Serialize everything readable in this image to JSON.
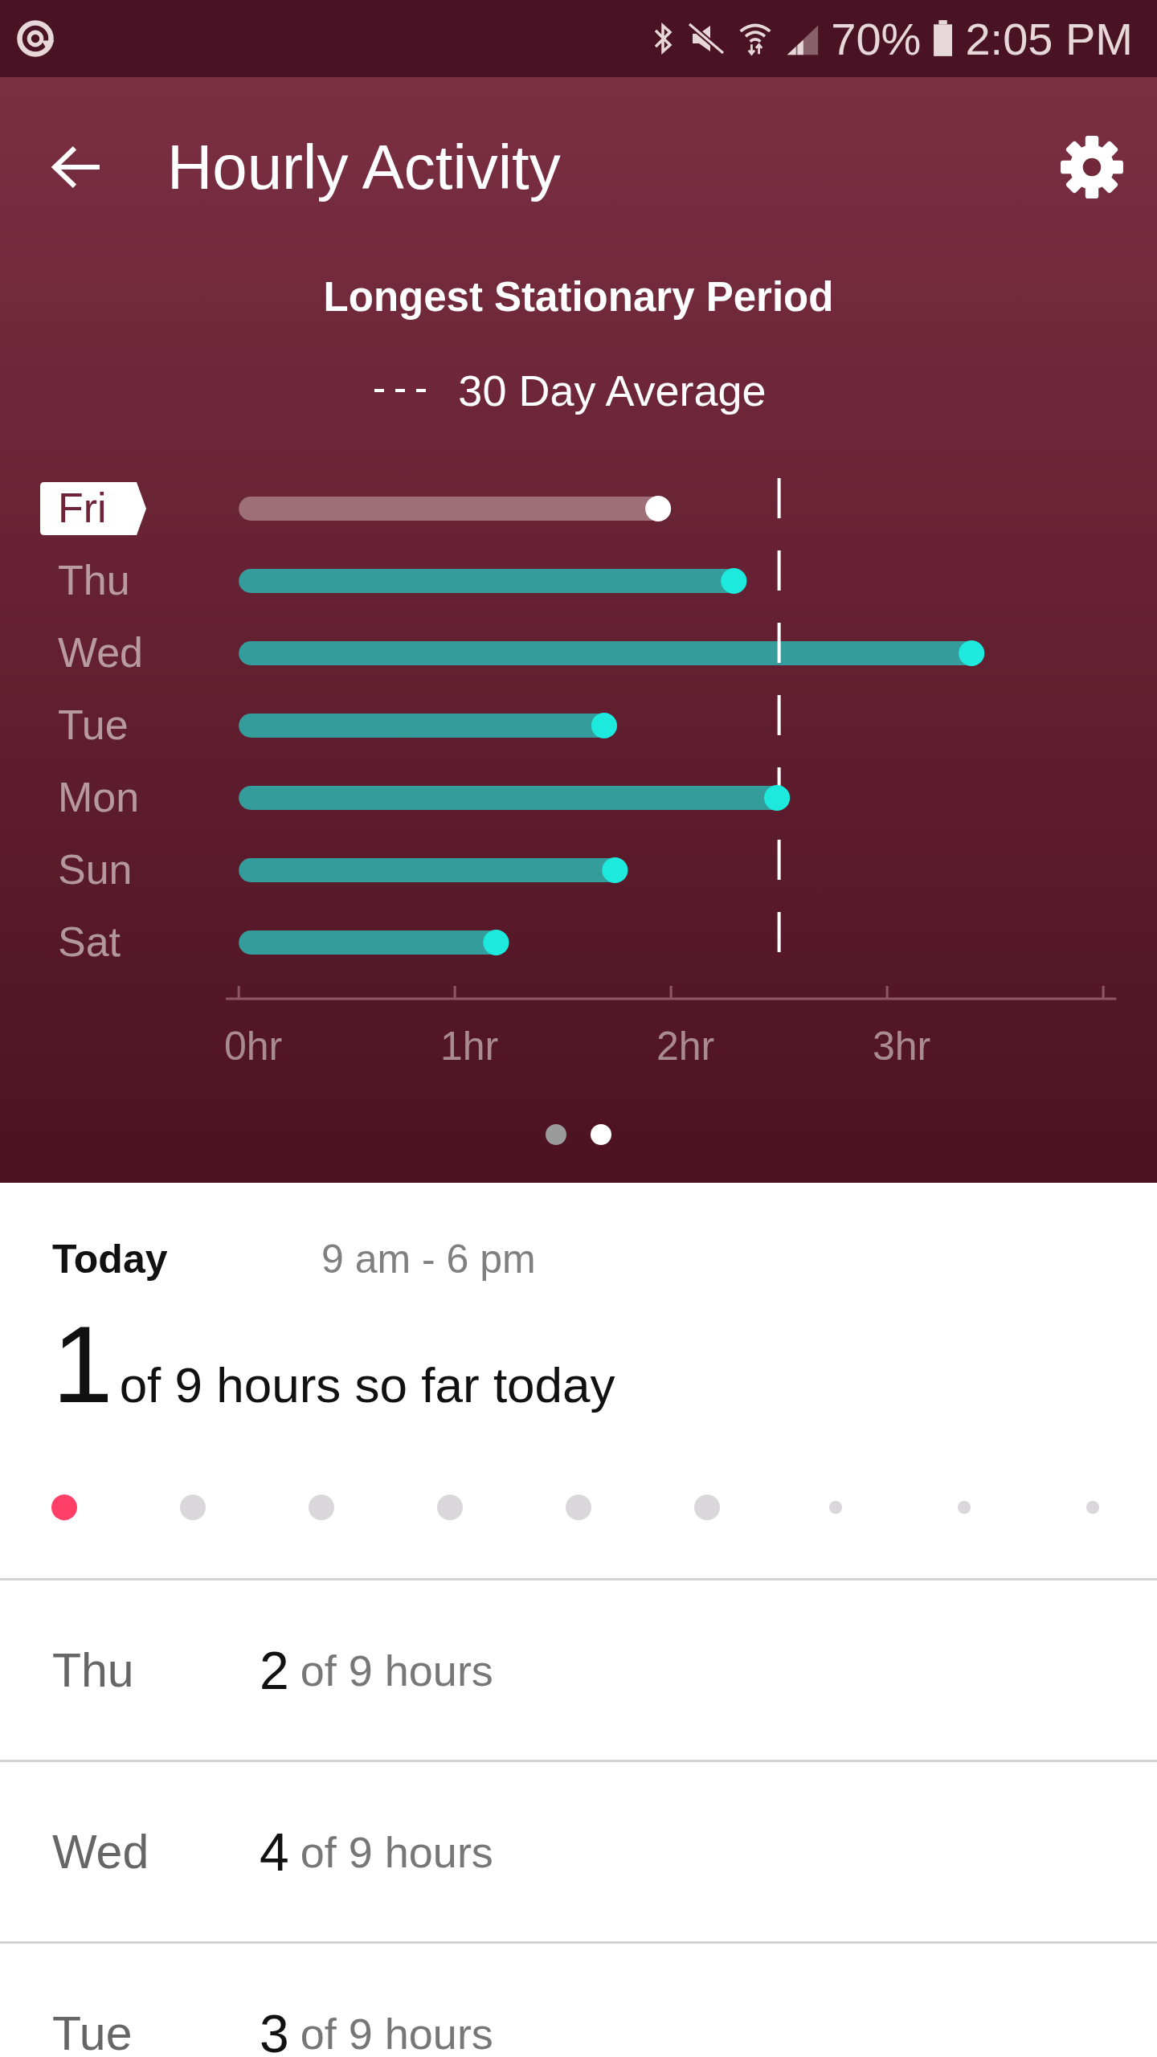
{
  "status_bar": {
    "battery": "70%",
    "time": "2:05 PM"
  },
  "header": {
    "title": "Hourly Activity"
  },
  "chart": {
    "title": "Longest Stationary Period",
    "days": [
      {
        "selected": true
      },
      {
        "selected": false
      },
      {
        "selected": false
      },
      {
        "selected": false
      },
      {
        "selected": false
      },
      {
        "selected": false
      },
      {
        "selected": false
      }
    ],
    "chart_data": {
      "type": "bar",
      "orientation": "horizontal",
      "categories": [
        "Fri",
        "Thu",
        "Wed",
        "Tue",
        "Mon",
        "Sun",
        "Sat"
      ],
      "values": [
        2.0,
        2.35,
        3.45,
        1.75,
        2.55,
        1.8,
        1.25
      ],
      "xlim": [
        -0.06,
        4.06
      ],
      "xticks": [
        {
          "value": 0,
          "label": "0hr"
        },
        {
          "value": 1,
          "label": "1hr"
        },
        {
          "value": 2,
          "label": "2hr"
        },
        {
          "value": 3,
          "label": "3hr"
        }
      ],
      "ref_lines": [
        {
          "axis": "x",
          "value": 2.5,
          "label": "30 Day Average"
        }
      ]
    }
  },
  "pager": [
    {
      "selected": false
    },
    {
      "selected": true
    }
  ],
  "today": {
    "label": "Today",
    "range": "9 am - 6 pm",
    "count": "1",
    "summary": "of 9 hours so far today",
    "hours": [
      {
        "kind": "active"
      },
      {
        "kind": "past"
      },
      {
        "kind": "past"
      },
      {
        "kind": "past"
      },
      {
        "kind": "past"
      },
      {
        "kind": "past"
      },
      {
        "kind": "future"
      },
      {
        "kind": "future"
      },
      {
        "kind": "future"
      }
    ]
  },
  "days": [
    {
      "day": "Thu",
      "count": "2",
      "summary": "of 9 hours"
    },
    {
      "day": "Wed",
      "count": "4",
      "summary": "of 9 hours"
    },
    {
      "day": "Tue",
      "count": "3",
      "summary": "of 9 hours"
    }
  ]
}
